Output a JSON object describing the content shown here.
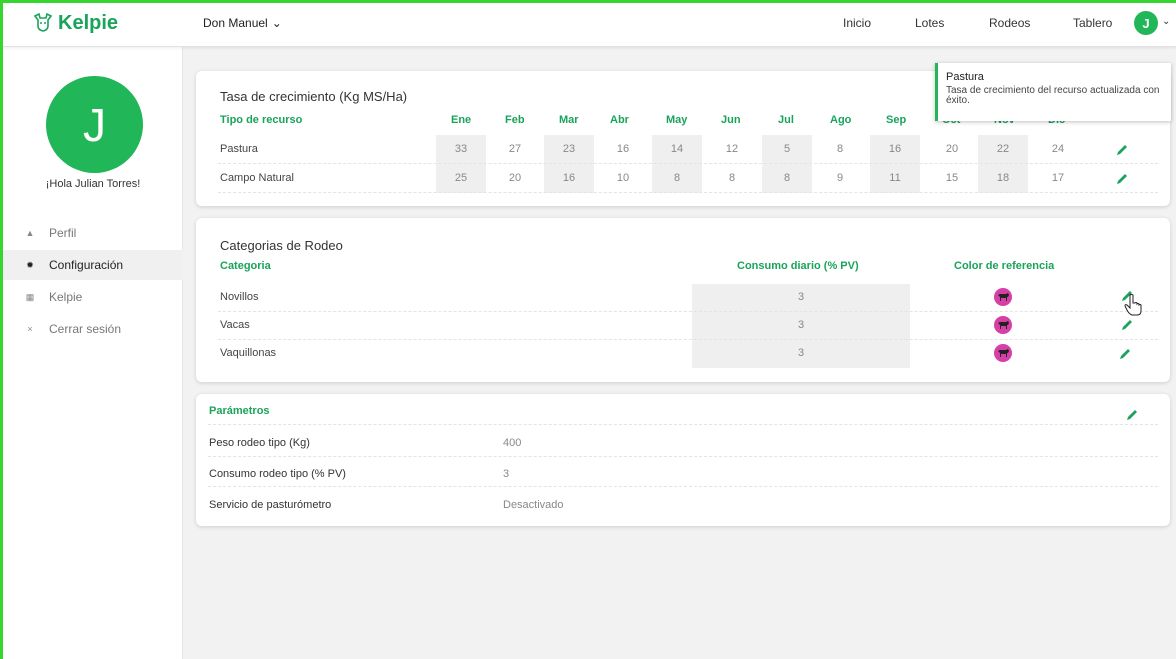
{
  "app": {
    "brand": "Kelpie",
    "accent": "#1aa35a",
    "avatar_color": "#21b759",
    "cow_color": "#d63fa6"
  },
  "topbar": {
    "establishment": "Don Manuel",
    "nav": [
      "Inicio",
      "Lotes",
      "Rodeos",
      "Tablero"
    ],
    "avatar_letter": "J"
  },
  "sidebar": {
    "avatar_letter": "J",
    "greeting": "¡Hola Julian Torres!",
    "items": [
      {
        "label": "Perfil",
        "icon": "person-icon"
      },
      {
        "label": "Configuración",
        "icon": "gear-icon",
        "active": true
      },
      {
        "label": "Kelpie",
        "icon": "building-icon"
      },
      {
        "label": "Cerrar sesión",
        "icon": "close-icon"
      }
    ]
  },
  "growth": {
    "title": "Tasa de crecimiento (Kg MS/Ha)",
    "header_label": "Tipo de recurso",
    "months": [
      "Ene",
      "Feb",
      "Mar",
      "Abr",
      "May",
      "Jun",
      "Jul",
      "Ago",
      "Sep",
      "Oct",
      "Nov",
      "Dic"
    ],
    "rows": [
      {
        "label": "Pastura",
        "values": [
          "33",
          "27",
          "23",
          "16",
          "14",
          "12",
          "5",
          "8",
          "16",
          "20",
          "22",
          "24"
        ]
      },
      {
        "label": "Campo Natural",
        "values": [
          "25",
          "20",
          "16",
          "10",
          "8",
          "8",
          "8",
          "9",
          "11",
          "15",
          "18",
          "17"
        ]
      }
    ]
  },
  "categories": {
    "title": "Categorias de Rodeo",
    "col_category": "Categoria",
    "col_consumption": "Consumo diario (% PV)",
    "col_color": "Color de referencia",
    "rows": [
      {
        "label": "Novillos",
        "consumption": "3"
      },
      {
        "label": "Vacas",
        "consumption": "3"
      },
      {
        "label": "Vaquillonas",
        "consumption": "3"
      }
    ]
  },
  "params": {
    "title": "Parámetros",
    "rows": [
      {
        "label": "Peso rodeo tipo (Kg)",
        "value": "400"
      },
      {
        "label": "Consumo rodeo tipo (% PV)",
        "value": "3"
      },
      {
        "label": "Servicio de pasturómetro",
        "value": "Desactivado"
      }
    ]
  },
  "toast": {
    "title": "Pastura",
    "message": "Tasa de crecimiento del recurso actualizada con éxito."
  }
}
